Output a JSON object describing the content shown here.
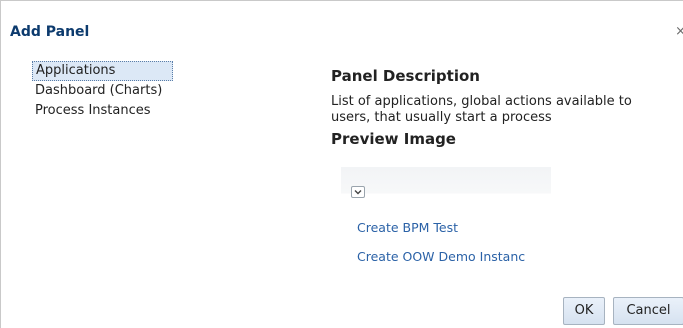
{
  "dialog": {
    "title": "Add Panel",
    "close_glyph": "×"
  },
  "panels": [
    {
      "label": "Applications",
      "selected": true
    },
    {
      "label": "Dashboard (Charts)",
      "selected": false
    },
    {
      "label": "Process Instances",
      "selected": false
    }
  ],
  "description": {
    "heading": "Panel Description",
    "text": "List of applications, global actions available to users, that usually start a process"
  },
  "preview": {
    "heading": "Preview Image",
    "dropdown_icon": "chevron-down-icon",
    "links": [
      "Create BPM Test",
      "Create OOW Demo Instanc"
    ]
  },
  "buttons": {
    "ok": "OK",
    "cancel": "Cancel"
  },
  "colors": {
    "title": "#0d3b6e",
    "link": "#2b62a7",
    "selection": "#dce8f6"
  }
}
